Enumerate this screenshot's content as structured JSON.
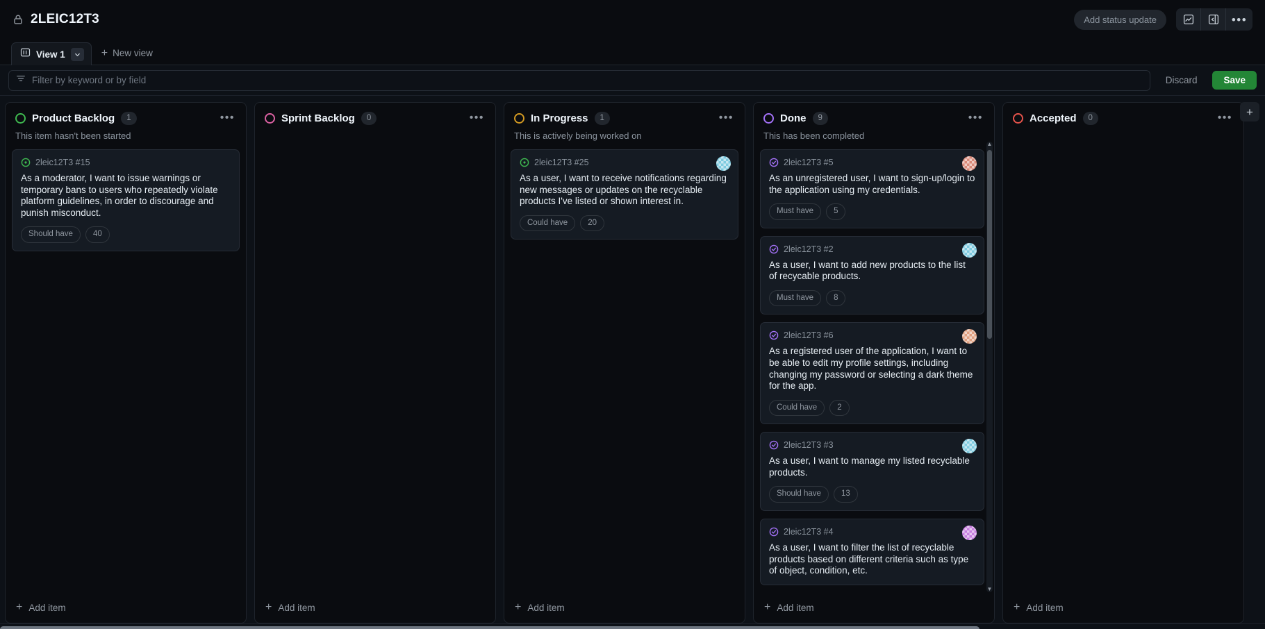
{
  "header": {
    "lock_icon": "lock-icon",
    "title": "2LEIC12T3",
    "status_update_label": "Add status update",
    "insights_icon": "insights-chart-icon",
    "sidebar_toggle_icon": "sidebar-expand-icon",
    "more_icon": "kebab-menu-icon",
    "more_glyph": "•••"
  },
  "tabs": {
    "board_icon": "board-view-icon",
    "view_label": "View 1",
    "caret_icon": "chevron-down-icon",
    "new_view_label": "New view",
    "new_view_plus": "+"
  },
  "filter": {
    "icon": "filter-icon",
    "placeholder": "Filter by keyword or by field",
    "value": "",
    "discard_label": "Discard",
    "save_label": "Save",
    "save_color": "#238636"
  },
  "board": {
    "add_item_label": "Add item",
    "add_column_glyph": "+",
    "menu_glyph": "•••",
    "columns": [
      {
        "name": "Product Backlog",
        "count": "1",
        "dot_color": "#3fb950",
        "description": "This item hasn't been started",
        "cards": [
          {
            "ref": "2leic12T3 #15",
            "state": "open",
            "state_color": "#3fb950",
            "title": "As a moderator, I want to issue warnings or temporary bans to users who repeatedly violate platform guidelines, in order to discourage and punish misconduct.",
            "priority": "Should have",
            "points": "40",
            "avatar": null
          }
        ]
      },
      {
        "name": "Sprint Backlog",
        "count": "0",
        "dot_color": "#db61a2",
        "description": "",
        "cards": []
      },
      {
        "name": "In Progress",
        "count": "1",
        "dot_color": "#d29922",
        "description": "This is actively being worked on",
        "cards": [
          {
            "ref": "2leic12T3 #25",
            "state": "open",
            "state_color": "#3fb950",
            "title": "As a user, I want to receive notifications regarding new messages or updates on the recyclable products I've listed or shown interest in.",
            "priority": "Could have",
            "points": "20",
            "avatar": "#7ecbe0"
          }
        ]
      },
      {
        "name": "Done",
        "count": "9",
        "dot_color": "#a371f7",
        "description": "This has been completed",
        "cards": [
          {
            "ref": "2leic12T3 #5",
            "state": "closed",
            "state_color": "#a371f7",
            "title": "As an unregistered user, I want to sign-up/login to the application using my credentials.",
            "priority": "Must have",
            "points": "5",
            "avatar": "#d98a7a"
          },
          {
            "ref": "2leic12T3 #2",
            "state": "closed",
            "state_color": "#a371f7",
            "title": "As a user, I want to add new products to the list of recycable products.",
            "priority": "Must have",
            "points": "8",
            "avatar": "#7ecbe0"
          },
          {
            "ref": "2leic12T3 #6",
            "state": "closed",
            "state_color": "#a371f7",
            "title": "As a registered user of the application, I want to be able to edit my profile settings, including changing my password or selecting a dark theme for the app.",
            "priority": "Could have",
            "points": "2",
            "avatar": "#e0a080"
          },
          {
            "ref": "2leic12T3 #3",
            "state": "closed",
            "state_color": "#a371f7",
            "title": "As a user, I want to manage my listed recyclable products.",
            "priority": "Should have",
            "points": "13",
            "avatar": "#7ecbe0"
          },
          {
            "ref": "2leic12T3 #4",
            "state": "closed",
            "state_color": "#a371f7",
            "title": "As a user, I want to filter the list of recyclable products based on different criteria such as type of object, condition, etc.",
            "priority": "",
            "points": "",
            "avatar": "#c77ee0"
          }
        ]
      },
      {
        "name": "Accepted",
        "count": "0",
        "dot_color": "#e5534b",
        "description": "",
        "cards": []
      }
    ]
  }
}
